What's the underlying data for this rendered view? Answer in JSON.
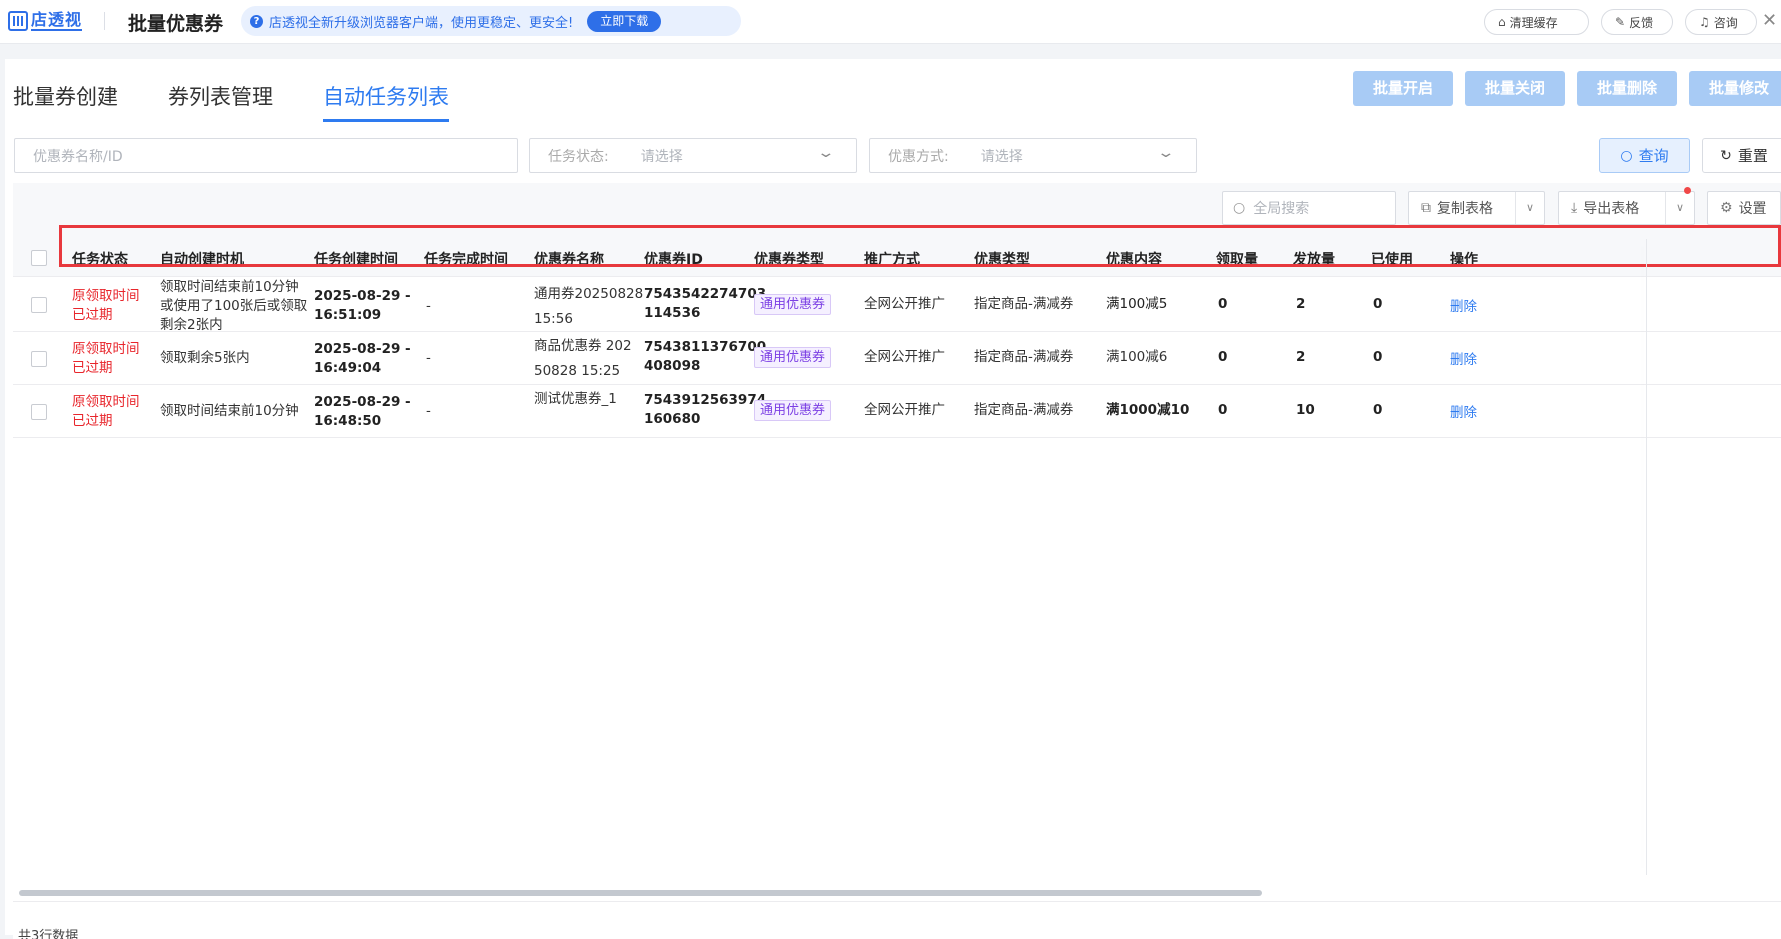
{
  "topbar": {
    "logo_text": "店透视",
    "title": "批量优惠券",
    "notice_text": "店透视全新升级浏览器客户端，使用更稳定、更安全!",
    "download_label": "立即下载",
    "clear_cache_label": "清理缓存",
    "feedback_label": "反馈",
    "consult_label": "咨询"
  },
  "tabs": [
    {
      "label": "批量券创建",
      "active": false
    },
    {
      "label": "券列表管理",
      "active": false
    },
    {
      "label": "自动任务列表",
      "active": true
    }
  ],
  "batch_actions": {
    "enable": "批量开启",
    "close": "批量关闭",
    "delete": "批量删除",
    "modify": "批量修改"
  },
  "filters": {
    "name_placeholder": "优惠券名称/ID",
    "status_label": "任务状态:",
    "status_placeholder": "请选择",
    "method_label": "优惠方式:",
    "method_placeholder": "请选择",
    "query_label": "查询",
    "reset_label": "重置"
  },
  "toolbar": {
    "search_placeholder": "全局搜索",
    "copy_label": "复制表格",
    "export_label": "导出表格",
    "settings_label": "设置"
  },
  "table": {
    "columns": [
      "任务状态",
      "自动创建时机",
      "任务创建时间",
      "任务完成时间",
      "优惠券名称",
      "优惠券ID",
      "优惠券类型",
      "推广方式",
      "优惠类型",
      "优惠内容",
      "领取量",
      "发放量",
      "已使用",
      "操作"
    ],
    "rows": [
      {
        "status_line1": "原领取时间",
        "status_line2": "已过期",
        "trigger_line1": "领取时间结束前10分钟",
        "trigger_line2": "或使用了100张后或领取",
        "trigger_line3": "剩余2张内",
        "created_line1": "2025-08-29 -",
        "created_line2": "16:51:09",
        "completed": "-",
        "name_line1": "通用券20250828",
        "name_line2": "15:56",
        "id_line1": "7543542274703",
        "id_line2": "114536",
        "coupon_type": "通用优惠券",
        "promotion": "全网公开推广",
        "discount_type": "指定商品-满减券",
        "discount_content": "满100减5",
        "claimed": "0",
        "issued": "2",
        "used": "0",
        "action": "删除"
      },
      {
        "status_line1": "原领取时间",
        "status_line2": "已过期",
        "trigger_line1": "领取剩余5张内",
        "trigger_line2": "",
        "trigger_line3": "",
        "created_line1": "2025-08-29 -",
        "created_line2": "16:49:04",
        "completed": "-",
        "name_line1": "商品优惠券 202",
        "name_line2": "50828 15:25",
        "id_line1": "7543811376700",
        "id_line2": "408098",
        "coupon_type": "通用优惠券",
        "promotion": "全网公开推广",
        "discount_type": "指定商品-满减券",
        "discount_content": "满100减6",
        "claimed": "0",
        "issued": "2",
        "used": "0",
        "action": "删除"
      },
      {
        "status_line1": "原领取时间",
        "status_line2": "已过期",
        "trigger_line1": "领取时间结束前10分钟",
        "trigger_line2": "",
        "trigger_line3": "",
        "created_line1": "2025-08-29 -",
        "created_line2": "16:48:50",
        "completed": "-",
        "name_line1": "测试优惠券_1",
        "name_line2": "",
        "id_line1": "7543912563974",
        "id_line2": "160680",
        "coupon_type": "通用优惠券",
        "promotion": "全网公开推广",
        "discount_type": "指定商品-满减券",
        "discount_content": "满1000减10",
        "claimed": "0",
        "issued": "10",
        "used": "0",
        "action": "删除"
      }
    ]
  },
  "footer": {
    "row_count": "共3行数据"
  },
  "colors": {
    "accent": "#2e7bf0",
    "expired_red": "#e8262c",
    "highlight_frame": "#e8383d",
    "coupon_tag": "#7b3fe4"
  }
}
